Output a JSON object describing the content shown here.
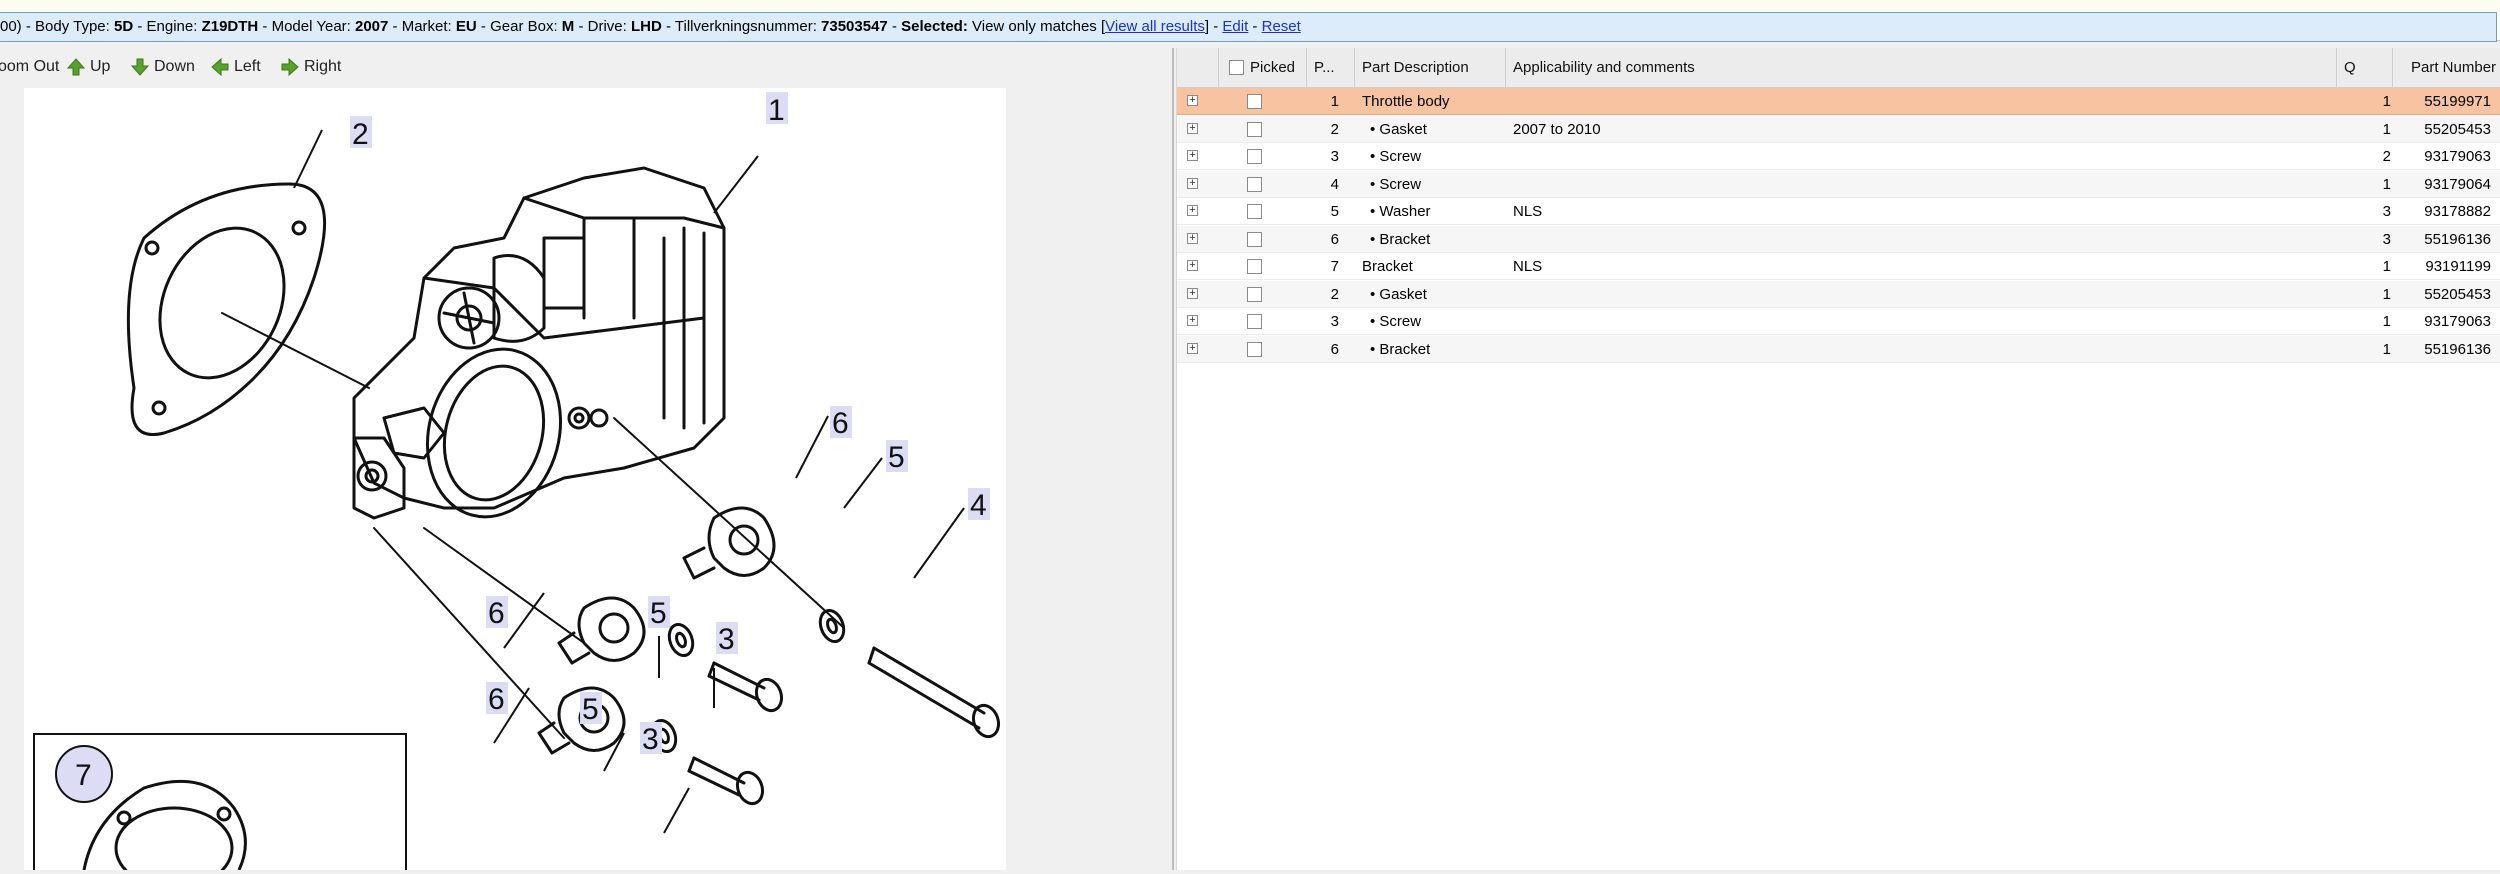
{
  "infobar": {
    "lead": "00)",
    "fields": [
      {
        "label": "Body Type:",
        "value": "5D"
      },
      {
        "label": "Engine:",
        "value": "Z19DTH"
      },
      {
        "label": "Model Year:",
        "value": "2007"
      },
      {
        "label": "Market:",
        "value": "EU"
      },
      {
        "label": "Gear Box:",
        "value": "M"
      },
      {
        "label": "Drive:",
        "value": "LHD"
      },
      {
        "label": "Tillverkningsnummer:",
        "value": "73503547"
      }
    ],
    "selected_label": "Selected:",
    "selected_text": "View only matches",
    "view_all": "View all results",
    "edit": "Edit",
    "reset": "Reset"
  },
  "toolbar": {
    "zoom_out": "oom Out",
    "up": "Up",
    "down": "Down",
    "left": "Left",
    "right": "Right"
  },
  "diagram": {
    "callouts": [
      "1",
      "2",
      "3",
      "3",
      "4",
      "5",
      "5",
      "5",
      "6",
      "6",
      "6",
      "7"
    ]
  },
  "table": {
    "headers": {
      "picked": "Picked",
      "pos": "P...",
      "description": "Part Description",
      "applicability": "Applicability and comments",
      "qty": "Q",
      "part_number": "Part Number"
    },
    "rows": [
      {
        "pos": "1",
        "description": "Throttle body",
        "applicability": "",
        "qty": "1",
        "part_number": "55199971"
      },
      {
        "pos": "2",
        "description": "• Gasket",
        "applicability": "2007 to 2010",
        "qty": "1",
        "part_number": "55205453"
      },
      {
        "pos": "3",
        "description": "• Screw",
        "applicability": "",
        "qty": "2",
        "part_number": "93179063"
      },
      {
        "pos": "4",
        "description": "• Screw",
        "applicability": "",
        "qty": "1",
        "part_number": "93179064"
      },
      {
        "pos": "5",
        "description": "• Washer",
        "applicability": "NLS",
        "qty": "3",
        "part_number": "93178882"
      },
      {
        "pos": "6",
        "description": "• Bracket",
        "applicability": "",
        "qty": "3",
        "part_number": "55196136"
      },
      {
        "pos": "7",
        "description": "Bracket",
        "applicability": "NLS",
        "qty": "1",
        "part_number": "93191199"
      },
      {
        "pos": "2",
        "description": "• Gasket",
        "applicability": "",
        "qty": "1",
        "part_number": "55205453"
      },
      {
        "pos": "3",
        "description": "• Screw",
        "applicability": "",
        "qty": "1",
        "part_number": "93179063"
      },
      {
        "pos": "6",
        "description": "• Bracket",
        "applicability": "",
        "qty": "1",
        "part_number": "55196136"
      }
    ]
  },
  "colors": {
    "selected_row": "#f8c3a0",
    "info_bar_bg": "#dcecfa",
    "link": "#1a33c8",
    "arrow_green": "#5aa02c",
    "callout_bg": "#dcdcf5"
  }
}
